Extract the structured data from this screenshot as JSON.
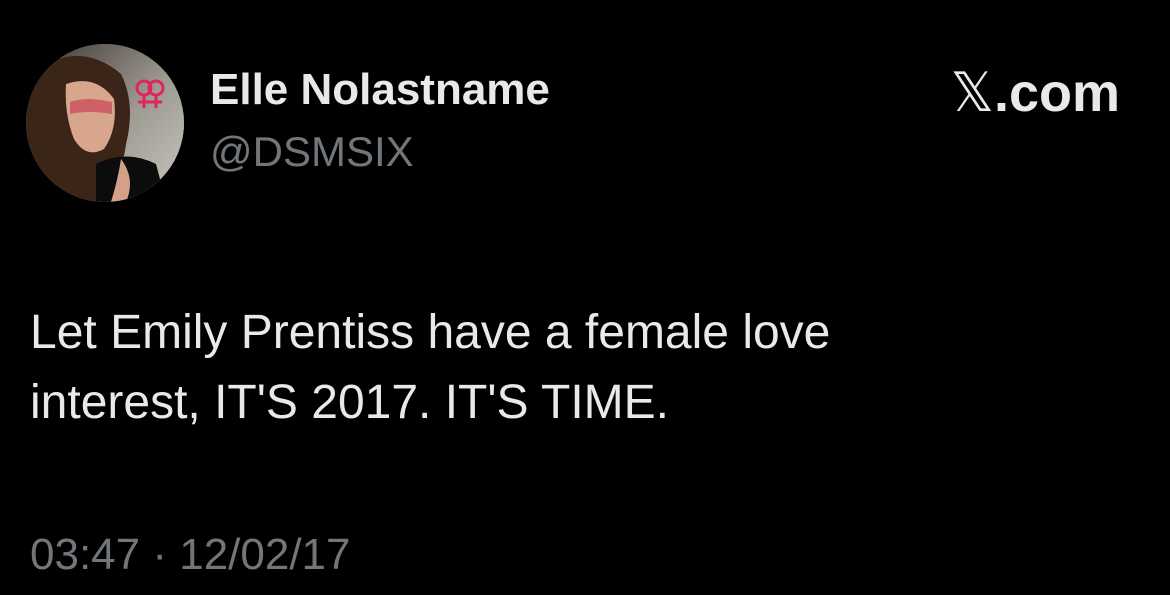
{
  "tweet": {
    "author": {
      "display_name": "Elle Nolastname",
      "handle": "@DSMSIX",
      "avatar": "profile-photo-with-venus-symbols"
    },
    "brand": {
      "logo": "𝕏",
      "suffix": ".com"
    },
    "text": {
      "line1": "Let Emily Prentiss have a female love",
      "line2": "interest, IT'S 2017. IT'S TIME."
    },
    "meta": {
      "time": "03:47",
      "separator": " · ",
      "date": "12/02/17"
    }
  },
  "colors": {
    "background": "#000000",
    "primary_text": "#e7e9ea",
    "secondary_text": "#71767b",
    "accent_symbol": "#e0245e"
  }
}
